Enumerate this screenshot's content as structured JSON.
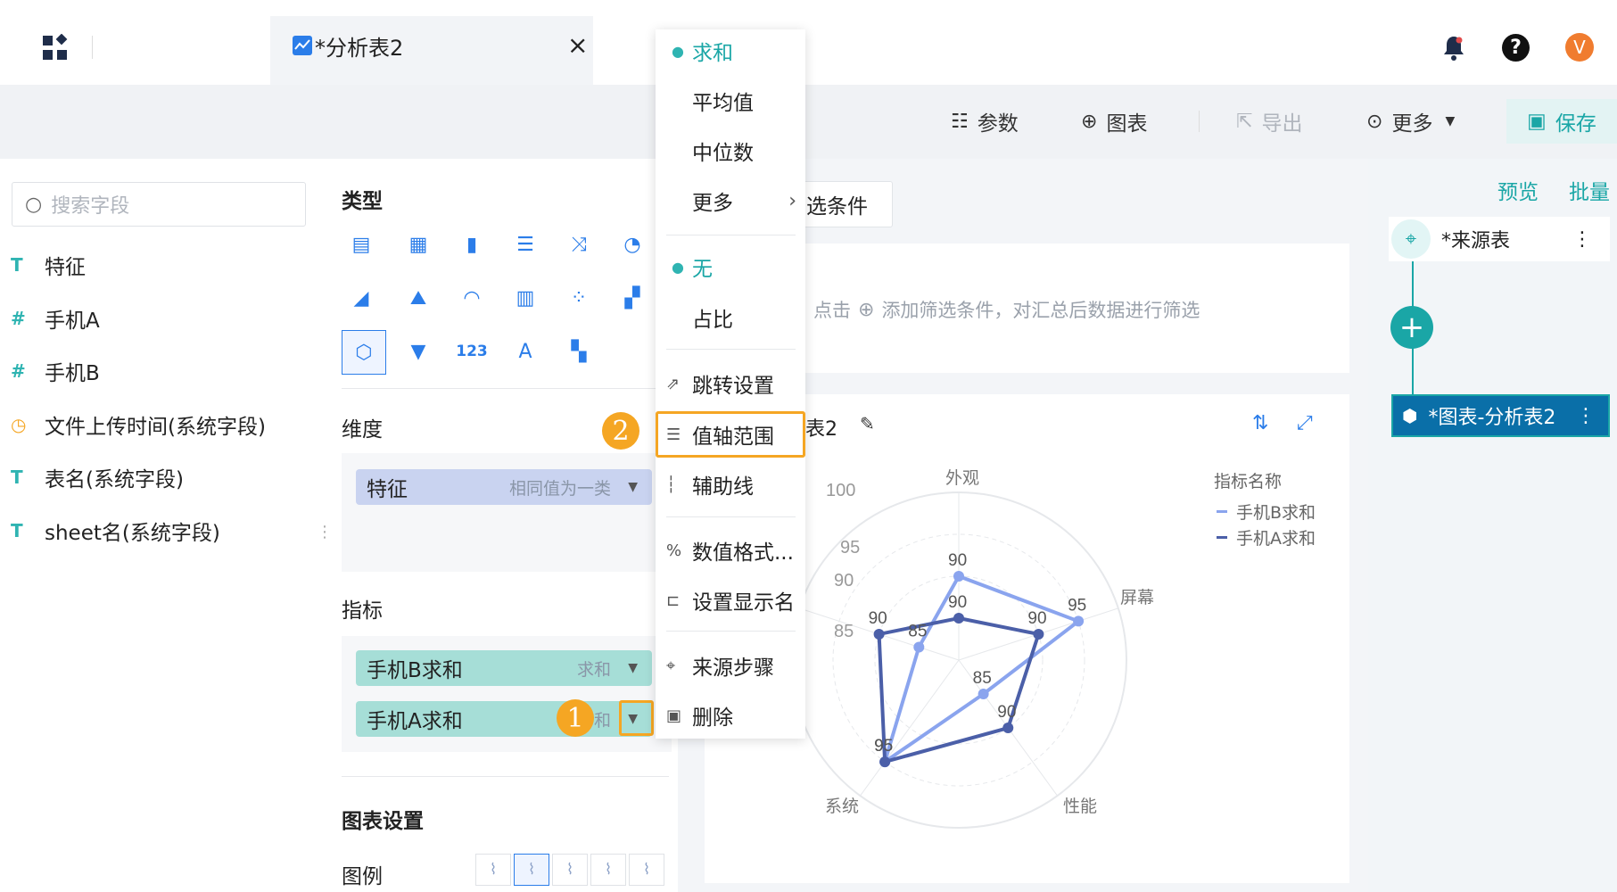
{
  "topbar": {
    "tab_title": "*分析表2",
    "close": "×",
    "user_initial": "V"
  },
  "toolbar": {
    "params": "参数",
    "chart": "图表",
    "export": "导出",
    "more": "更多",
    "save": "保存"
  },
  "left": {
    "search_placeholder": "搜索字段",
    "fields": [
      {
        "icon": "T",
        "label": "特征"
      },
      {
        "icon": "#",
        "label": "手机A"
      },
      {
        "icon": "#",
        "label": "手机B"
      },
      {
        "icon": "◷",
        "label": "文件上传时间(系统字段)"
      },
      {
        "icon": "T",
        "label": "表名(系统字段)"
      },
      {
        "icon": "T",
        "label": "sheet名(系统字段)"
      }
    ]
  },
  "middle": {
    "type_label": "类型",
    "dimension_label": "维度",
    "dimension_pill": {
      "label": "特征",
      "sub": "相同值为一类"
    },
    "metric_label": "指标",
    "metric_pills": [
      {
        "label": "手机B求和",
        "sub": "求和"
      },
      {
        "label": "手机A求和",
        "sub": "和"
      }
    ],
    "chart_settings": "图表设置",
    "legend": "图例"
  },
  "menu": {
    "items": [
      "求和",
      "平均值",
      "中位数",
      "更多",
      "无",
      "占比",
      "跳转设置",
      "值轴范围",
      "辅助线",
      "数值格式...",
      "设置显示名",
      "来源步骤",
      "删除"
    ]
  },
  "canvas": {
    "filter_btn": "选条件",
    "filter_hint_pre": "点击",
    "filter_hint": "添加筛选条件，对汇总后数据进行筛选",
    "chart_title": "表2",
    "legend_title": "指标名称",
    "legend_items": [
      "手机B求和",
      "手机A求和"
    ]
  },
  "right": {
    "preview": "预览",
    "batch": "批量",
    "node_source": "*来源表",
    "node_chart": "*图表-分析表2"
  },
  "badges": [
    "1",
    "2"
  ],
  "colors": {
    "teal": "#2fb4b2",
    "accent_blue": "#0a6fa8",
    "series_b": "#8aa4ee",
    "series_a": "#4b5fa8",
    "badge": "#f5a623"
  },
  "chart_data": {
    "type": "radar",
    "categories": [
      "外观",
      "屏幕",
      "性能",
      "系统",
      ""
    ],
    "ticks": [
      "100",
      "95",
      "90",
      "85"
    ],
    "series": [
      {
        "name": "手机B求和",
        "values": [
          90,
          95,
          85,
          95,
          85
        ]
      },
      {
        "name": "手机A求和",
        "values": [
          85,
          90,
          90,
          95,
          90
        ]
      }
    ],
    "data_labels_b": [
      "90",
      "95",
      "85",
      "95",
      "85"
    ],
    "data_labels_a": [
      "90",
      "90",
      "90",
      "95",
      "90"
    ]
  }
}
